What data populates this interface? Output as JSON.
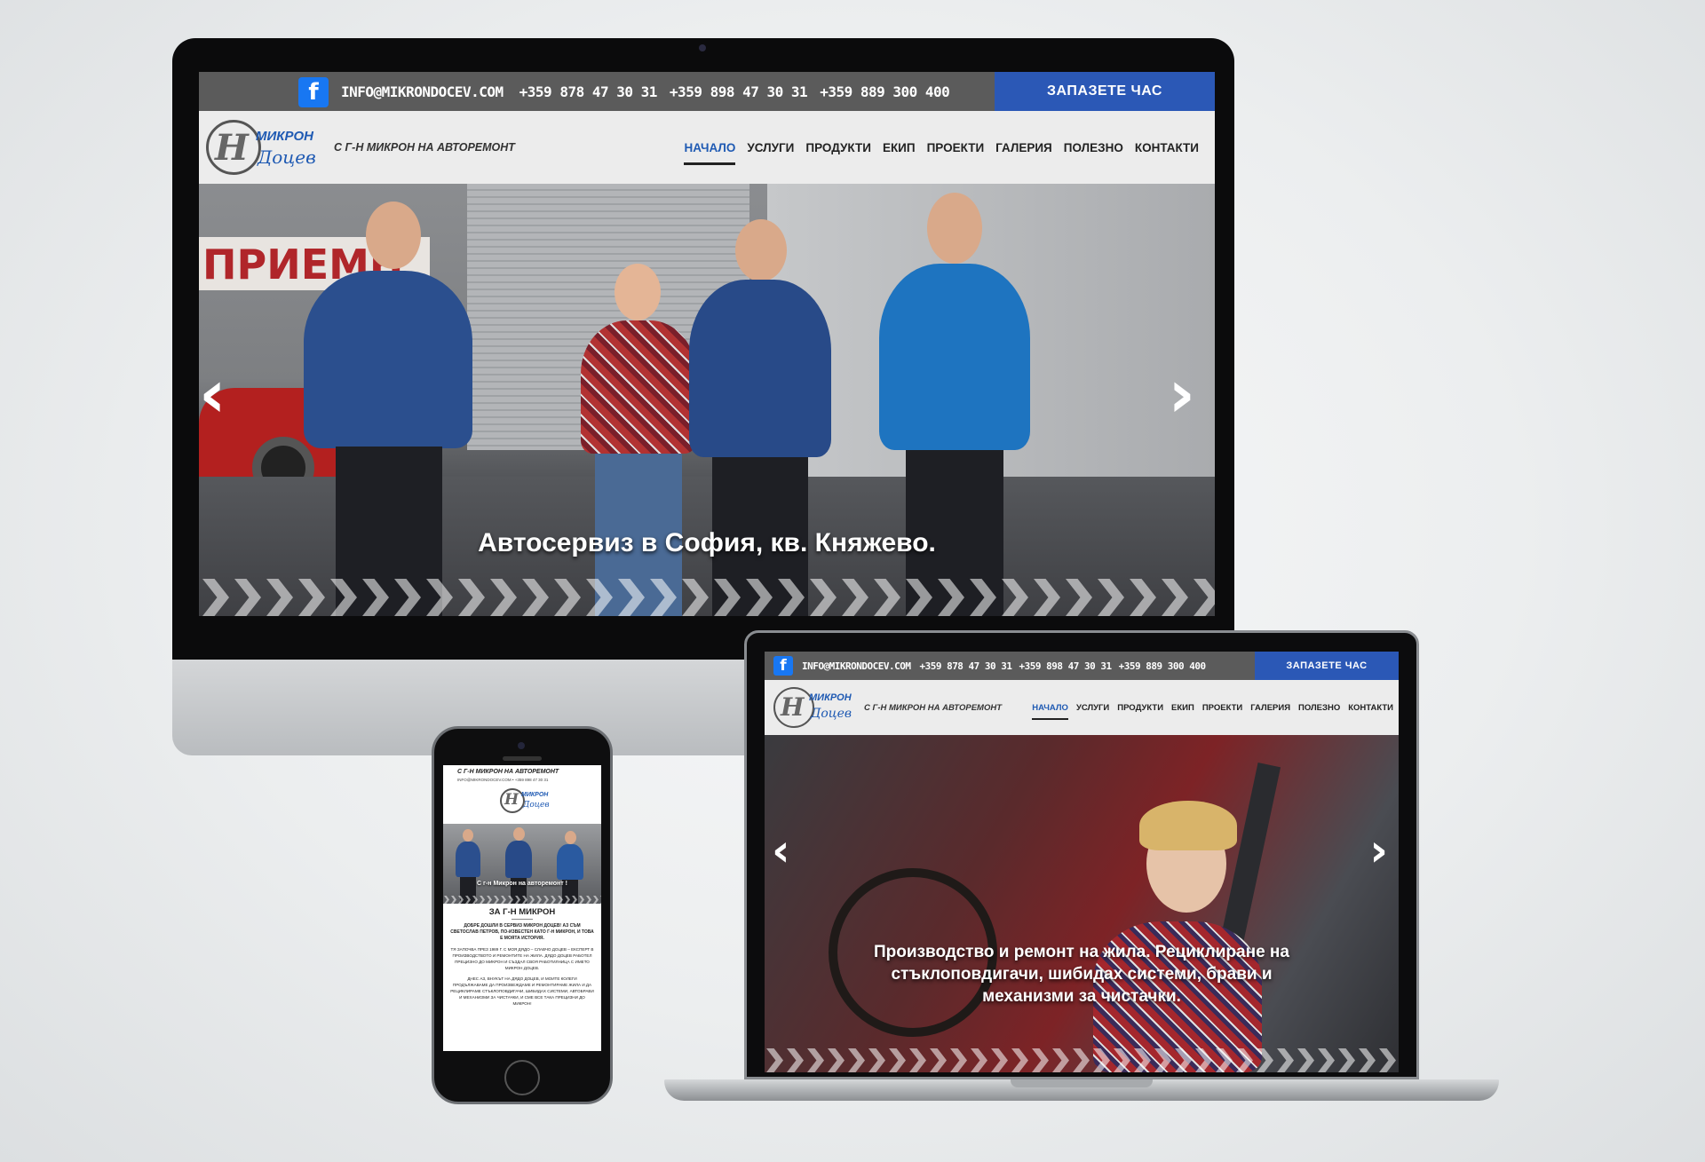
{
  "site": {
    "email": "INFO@MIKRONDOCEV.COM",
    "phones": [
      "+359 878 47 30 31",
      "+359 898 47 30 31",
      "+359 889 300 400"
    ],
    "cta": "ЗАПАЗЕТЕ ЧАС",
    "fb_icon": "f",
    "logo_word1": "МИКРОН",
    "logo_word2": "Доцев",
    "tagline": "С Г-Н МИКРОН НА АВТОРЕМОНТ",
    "nav": [
      "НАЧАЛО",
      "УСЛУГИ",
      "ПРОДУКТИ",
      "ЕКИП",
      "ПРОЕКТИ",
      "ГАЛЕРИЯ",
      "ПОЛЕЗНО",
      "КОНТАКТИ"
    ],
    "arrow_left": "‹",
    "arrow_right": "›"
  },
  "desktop": {
    "sign_text": "ПРИЕМН",
    "caption": "Автосервиз в София, кв. Княжево."
  },
  "laptop": {
    "caption_lines": [
      "Производство и ремонт на жила. Рециклиране на",
      "стъклоповдигачи, шибидах системи, брави и",
      "механизми за чистачки."
    ]
  },
  "phone": {
    "tagline": "С Г-Н МИКРОН НА АВТОРЕМОНТ",
    "contact_line": "INFO@MIKRONDOCEV.COM • +359 898 47 30 31",
    "banner": "С г-н Микрон на авторемонт !",
    "section_title": "ЗА Г-Н МИКРОН",
    "intro": "ДОБРЕ ДОШЛИ В СЕРВИЗ МИКРОН ДОЦЕВ! АЗ СЪМ СВЕТОСЛАВ ПЕТРОВ, ПО-ИЗВЕСТЕН КАТО Г-Н МИКРОН, И ТОВА Е МОЯТА ИСТОРИЯ.",
    "para1": "ТЯ ЗАПОЧВА ПРЕЗ 1989 Г. С МОЯ ДЯДО – СЛАВЧО ДОЦЕВ – ЕКСПЕРТ В ПРОИЗВОДСТВОТО И РЕМОНТИТЕ НА ЖИЛА. ДЯДО ДОЦЕВ РАБОТЕЛ ПРЕЦИЗНО ДО МИКРОН И СЪЗДАЛ СВОЯ РАБОТИЛНИЦА С ИМЕТО МИКРОН ДОЦЕВ.",
    "para2": "ДНЕС АЗ, ВНУКЪТ НА ДЯДО ДОЦЕВ, И МОИТЕ КОЛЕГИ ПРОДЪЛЖАВАМЕ ДА ПРОИЗВЕЖДАМЕ И РЕМОНТИРАМЕ ЖИЛА И ДА РЕЦИКЛИРАМЕ СТЪКЛОПОВДИГАЧИ, ШИБИДАХ СИСТЕМИ, АВТОБРАВИ И МЕХАНИЗМИ ЗА ЧИСТАЧКИ, И СМЕ ВСЕ ТАКА ПРЕЦИЗНИ ДО МИКРОН!"
  },
  "colors": {
    "topbar": "#5b5b5b",
    "cta": "#2b58b6",
    "accent": "#1f5ab3",
    "header": "#ececec",
    "facebook": "#1877f2"
  }
}
